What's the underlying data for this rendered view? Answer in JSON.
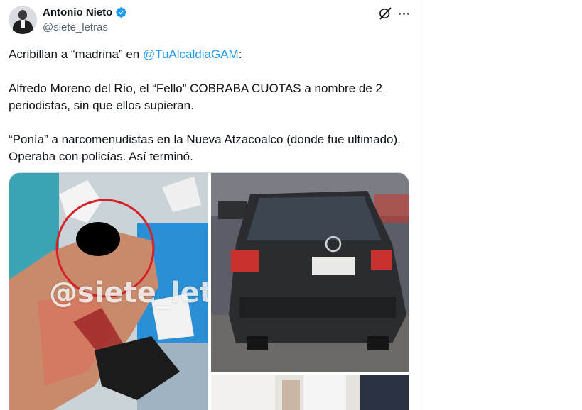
{
  "author": {
    "display_name": "Antonio Nieto",
    "handle": "@siete_letras",
    "verified": true
  },
  "icons": {
    "avatar": "avatar-photo",
    "verified": "verified-badge-icon",
    "grok": "grok-icon",
    "more": "more-options-icon"
  },
  "colors": {
    "link": "#1d9bf0",
    "secondary_text": "#536471",
    "verified": "#1d9bf0"
  },
  "tweet": {
    "line1_before": "Acribillan a “madrina” en ",
    "line1_mention": "@TuAlcaldiaGAM",
    "line1_after": ":",
    "paragraph2": "Alfredo Moreno del Río, el “Fello” COBRABA CUOTAS a nombre de 2 periodistas, sin que ellos supieran.",
    "paragraph3": "“Ponía” a narcomenudistas en la Nueva Atzacoalco (donde fue ultimado). Operaba con policías. Así terminó."
  },
  "media": {
    "watermark": "@siete_letras"
  }
}
